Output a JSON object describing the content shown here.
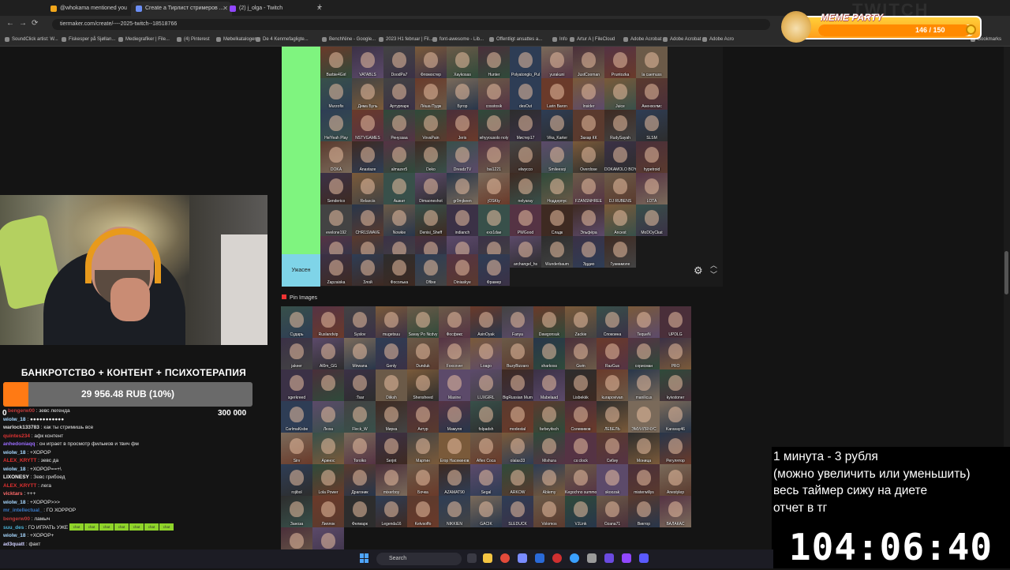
{
  "browser": {
    "tabs": [
      {
        "label": "@whokama mentioned you",
        "color": "#f2a71b"
      },
      {
        "label": "Create a Тирлист стримеров ...",
        "color": "#6b8ef5"
      },
      {
        "label": "(2) j_olga - Twitch",
        "color": "#9147ff"
      }
    ],
    "new_tab_symbol": "+",
    "url": "tiermaker.com/create/----2025-twitch--18518766",
    "bookmarks": [
      "SoundClick artist: W...",
      "Fiskesper på Sjøllan...",
      "Mediegrafiker | File...",
      "(4) Pinterest",
      "Møbelkataloger",
      "De 4 Kenmefagligte...",
      "BenchNine - Google...",
      "2023 H1 februar | Fil...",
      "font-awesome - Lib...",
      "Offentligt ansattes a...",
      "Info",
      "Artur A | FileCloud",
      "Adobe Acrobat",
      "Adobe Acrobat",
      "Adobe Acro"
    ],
    "bookmarks_right": "Bookmarks"
  },
  "tier_list": {
    "row_s_names": [
      "Barbie4Girl",
      "VATABLS",
      "DoodPa7",
      "Фломостер",
      "Xaykosas",
      "Hunter",
      "Polyatonglo_Pul",
      "yurakuni",
      "JustCooman",
      "Pruntozka",
      "la caemuss",
      "Murzofix",
      "Дима Буль",
      "Артурпарк",
      "Лёша Пудж",
      "Бугор",
      "cosstosik",
      "desOut",
      "Larin Baron",
      "Insider",
      "Juice",
      "Аненхолмс",
      "HelYeah Play",
      "NSTVGAMES",
      "Ренуззаа",
      "VovaPain",
      "Jeris",
      "whyyousolo noly",
      "Мистер17",
      "Vika_Karter",
      "Захар КК",
      "RudySayah",
      "SLSM",
      "DOKA",
      "Anastaze",
      "almazer5",
      "Deko",
      "DreadzTV",
      "bai1221",
      "elwycco",
      "Smileesqi",
      "Overdose",
      "DOKAMOLO BOY",
      "hypetroid",
      "Senderico",
      "Relaxcis",
      "Ашкат",
      "Dimaoneshot",
      "gr0mjkeen",
      "jOSKty",
      "nelyaray",
      "Ноддерпус",
      "FZANSNHREE",
      "DJ RUBENS",
      "LOTA",
      "evelone192",
      "CHR1SWAVE",
      "Nowkie",
      "Denisi_Sheff",
      "indianch",
      "exx1dae",
      "PWGood",
      "Сладк",
      "Эльфёра",
      "Ancest",
      "MoDOyCkat",
      "mellharuoos",
      "Shadow",
      "pulauchi23play",
      "QUICKHUNTIK",
      "KASANOFFF",
      "ILAME",
      "archangel_hs",
      "Wunderbaum",
      "Эддио",
      "Гуавамоле"
    ],
    "row_s_label": "",
    "row_s_color": "#7ff47f",
    "row_a_label": "Ужасен",
    "row_a_color": "#7fd4e8",
    "row_a_names": [
      "Zapzaiska",
      "Злой",
      "Фосолька",
      "Oflixe",
      "Diniaskye",
      "Фрамер"
    ],
    "settings_icon": "gear-icon",
    "move_up_icon": "chevron-up-icon",
    "move_down_icon": "chevron-down-icon"
  },
  "pin_images": {
    "label": "Pin Images",
    "names": [
      "Сударь",
      "Ruslandvip",
      "Syslov",
      "mugetsuu",
      "Savay Po Ncdvy",
      "Фосфикс",
      "AsinOyak",
      "Fanya",
      "Dawgonsuk",
      "Zackie",
      "Спокоина",
      "TequeN",
      "UPDLG",
      "jakeer",
      "Al0m_GG",
      "Mirwana",
      "Genly",
      "Dunduk",
      "Foxcover",
      "Loago",
      "BuzyBizzaro",
      "sharkoss",
      "Gwin",
      "RazGus",
      "сорисман",
      "PRO",
      "sgerkreed",
      "",
      ":Tsar",
      "Diiksh",
      "Shensheed",
      "Maxine",
      "LUXGIRL",
      "BigRussian Mum",
      "Mabelaad",
      "Lisbekkk",
      "kurapovivan",
      "manilicus",
      "kyivstoner",
      "CarlmaKisbe",
      "Люха",
      "Fleck_W",
      "Мирка",
      "Aктур",
      "Мамуля",
      "folpadsh",
      "modestal",
      "farbeyitsch",
      "Солевиков",
      "ЛЕБЕЛЬ",
      "ЭМУЙЛЯЧУС",
      "Karavay46",
      "Sirv",
      "Аринос",
      "Torolko",
      "Serjnt",
      "Мартин",
      "Егор Насекинов",
      "Aflex Coca",
      "olalas33",
      "Mishura",
      "cs:clock",
      "Сибиу",
      "Моница",
      "Регулятор",
      "rojibol",
      "Lola Power",
      "Драгоник",
      "mixerboy",
      "Бочка",
      "AZAMAT90",
      "Segal",
      "ARKOW",
      "Ablemy",
      "Kegochno summoner",
      "skoozak",
      "misterwillys",
      "Anestylep",
      "Заноза",
      "Лиллок",
      "Фелиарк",
      "Legenda16",
      "Ketvsoffo",
      "NIKKIEN",
      "GACIK",
      "SLEDUCK",
      "Volomos",
      "VJLink",
      "Ozana71",
      "Виктор",
      "ВАЛАКАС",
      "ПАПИЧ",
      "БЕБЕЙ"
    ]
  },
  "stream": {
    "goal_title": "БАНКРОТСТВО + КОНТЕНТ + ПСИХОТЕРАПИЯ",
    "goal_text": "29 956.48 RUB (10%)",
    "goal_progress": 0.1,
    "goal_min": "0",
    "goal_max": "300 000",
    "goal_color": "#ff7a14"
  },
  "chat": [
    {
      "user": "bengerw00",
      "text": "зевс легенда",
      "color": "#c23b3b"
    },
    {
      "user": "wiolw_18",
      "text": "●●●●●●●●●●●",
      "color": "#a8d8ff"
    },
    {
      "user": "warlock133783",
      "text": "как ты стримишь все",
      "color": "#e0e0e0"
    },
    {
      "user": "quintes234",
      "text": "афк контент",
      "color": "#d33"
    },
    {
      "user": "anhedoniaqq",
      "text": "он играет в просмотр фильмов и твич фм",
      "color": "#9b6cff"
    },
    {
      "user": "wiolw_18",
      "text": "+ХОРОР",
      "color": "#a8d8ff"
    },
    {
      "user": "ALEX_KRYTT",
      "text": "зевс да",
      "color": "#e03030"
    },
    {
      "user": "wiolw_18",
      "text": "+ХОРОР==+\\",
      "color": "#a8d8ff"
    },
    {
      "user": "LIXONESY",
      "text": "Зевс грибоед",
      "color": "#ffffff"
    },
    {
      "user": "ALEX_KRYTT",
      "text": "лега",
      "color": "#e03030"
    },
    {
      "user": "vicktars",
      "text": "+++",
      "color": "#ff6a6a"
    },
    {
      "user": "wiolw_18",
      "text": "+ХОРОР>>>",
      "color": "#a8d8ff"
    },
    {
      "user": "mr_intellectual_",
      "text": "ГО ХОРРОР",
      "color": "#3a7ac8"
    },
    {
      "user": "bengerw00",
      "text": "ламыч",
      "color": "#c23b3b"
    },
    {
      "user": "suu_des",
      "text": "ГО ИГРАТЬ УЖЕ",
      "color": "#4bb3d8"
    },
    {
      "user": "wiolw_18",
      "text": "+ХОРОР+",
      "color": "#a8d8ff"
    },
    {
      "user": "ad3quatt",
      "text": "факт",
      "color": "#d0d0ff"
    },
    {
      "user": "wiolw_18",
      "text": "+ХОРОР+=",
      "color": "#a8d8ff"
    }
  ],
  "chat_emote_label": "chat",
  "overlay": {
    "lines": [
      "1 минута - 3 рубля",
      "(можно увеличить или уменьшить)",
      "весь таймер сижу на диете",
      "отчет в тг"
    ],
    "timer": "104:06:40"
  },
  "meme_party": {
    "title": "MEME PARTY",
    "count": "146 / 150",
    "progress": 0.973
  },
  "watermark": "TWITCH",
  "taskbar": {
    "search_placeholder": "Search"
  }
}
